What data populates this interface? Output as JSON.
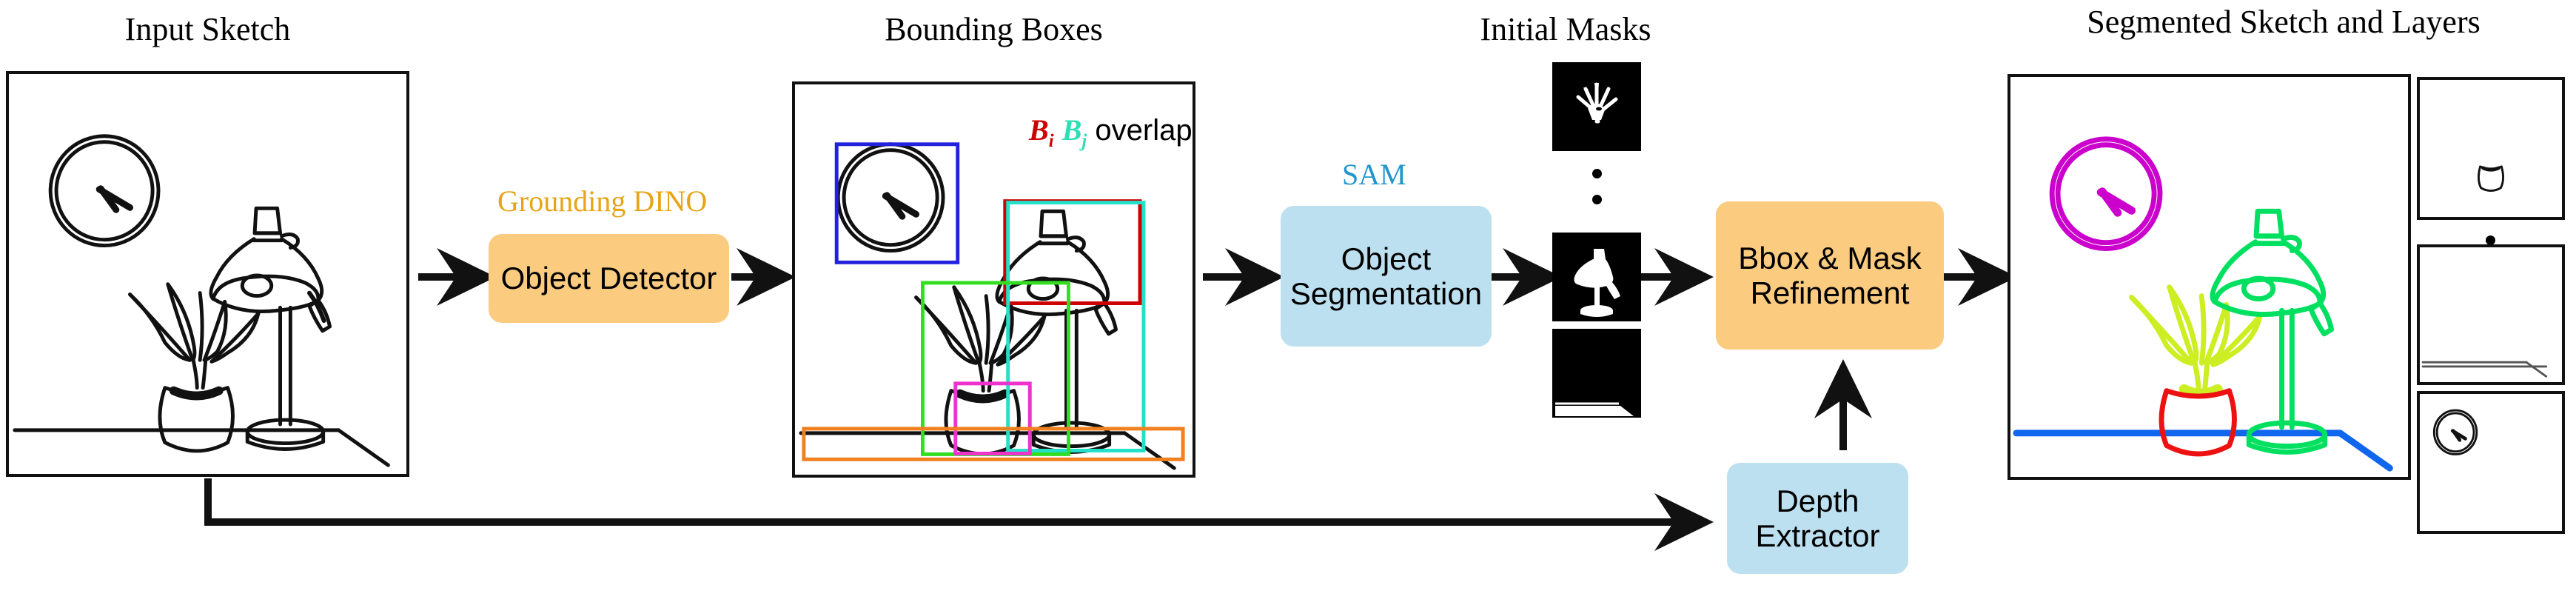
{
  "figure": {
    "type": "pipeline-diagram",
    "title": "Sketch Object Segmentation Pipeline"
  },
  "captions": {
    "input_sketch": "Input Sketch",
    "bounding_boxes": "Bounding Boxes",
    "initial_masks": "Initial Masks",
    "segmented": "Segmented Sketch and Layers"
  },
  "modules": [
    {
      "id": "object-detector",
      "model_label": "Grounding DINO",
      "box_label": "Object Detector",
      "box_color": "#FBCB80",
      "label_color": "#E8A317"
    },
    {
      "id": "object-segmentation",
      "model_label": "SAM",
      "box_label_line1": "Object",
      "box_label_line2": "Segmentation",
      "box_color": "#BDE0F0",
      "label_color": "#2196CE"
    },
    {
      "id": "bbox-mask-refinement",
      "model_label": "",
      "box_label_line1": "Bbox & Mask",
      "box_label_line2": "Refinement",
      "box_color": "#FBCB80",
      "label_color": "#E8A317"
    },
    {
      "id": "depth-extractor",
      "model_label": "",
      "box_label_line1": "Depth",
      "box_label_line2": "Extractor",
      "box_color": "#BDE0F0",
      "label_color": "#2196CE"
    }
  ],
  "annotation": {
    "bi": "B",
    "bi_sub": "i",
    "bj": "B",
    "bj_sub": "j",
    "overlap": "overlap",
    "bi_color": "#CC0000",
    "bj_color": "#2BE0B7"
  },
  "bounding_boxes": [
    {
      "object": "clock",
      "color": "#2222DD"
    },
    {
      "object": "lamp-head",
      "color": "#CC0000"
    },
    {
      "object": "lamp-full",
      "color": "#23E0C8"
    },
    {
      "object": "plant",
      "color": "#33DD22"
    },
    {
      "object": "pot",
      "color": "#EE33CC"
    },
    {
      "object": "table",
      "color": "#F08020"
    }
  ],
  "segment_colors": [
    {
      "object": "clock",
      "color": "#CC00CC"
    },
    {
      "object": "lamp",
      "color": "#00E060"
    },
    {
      "object": "plant",
      "color": "#CCEE22"
    },
    {
      "object": "pot",
      "color": "#EE1111"
    },
    {
      "object": "table",
      "color": "#1166EE"
    }
  ],
  "masks": [
    {
      "object": "plant",
      "background": "#000000",
      "foreground": "#FFFFFF"
    },
    {
      "object": "lamp",
      "background": "#000000",
      "foreground": "#FFFFFF"
    },
    {
      "object": "table",
      "background": "#000000",
      "foreground": "#FFFFFF"
    }
  ],
  "layers": [
    {
      "object": "pot"
    },
    {
      "object": "table"
    },
    {
      "object": "clock"
    }
  ],
  "ellipsis": {
    "glyph": "•",
    "count": 2
  }
}
